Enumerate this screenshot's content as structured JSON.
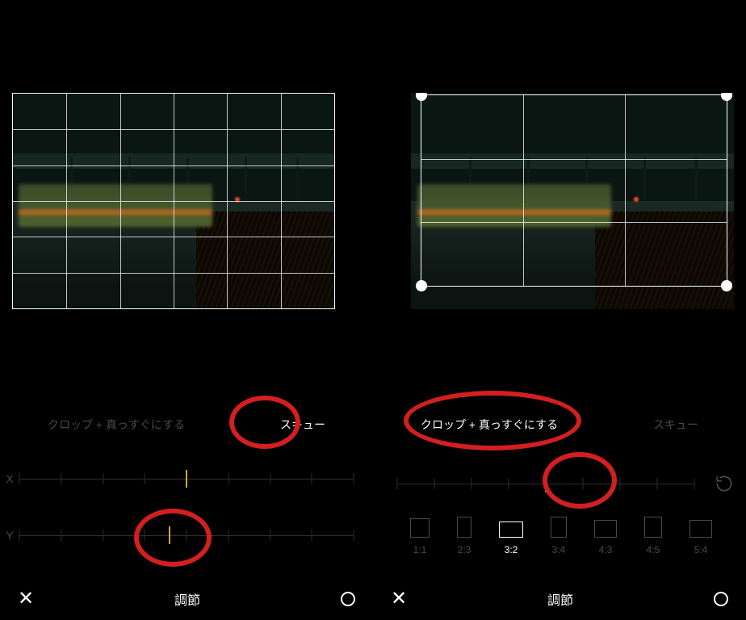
{
  "left_panel": {
    "tabs": {
      "crop_straighten": "クロップ + 真っすぐにする",
      "skew": "スキュー",
      "active": "skew"
    },
    "slider_x": {
      "label": "X",
      "cursor_pct": 50
    },
    "slider_y": {
      "label": "Y",
      "cursor_pct": 45
    },
    "footer": {
      "title": "調節"
    }
  },
  "right_panel": {
    "tabs": {
      "crop_straighten": "クロップ + 真っすぐにする",
      "skew": "スキュー",
      "active": "crop_straighten"
    },
    "slider": {
      "cursor_pct": 50
    },
    "aspect_ratios": [
      {
        "key": "1:1",
        "label": "1:1"
      },
      {
        "key": "2:3",
        "label": "2:3"
      },
      {
        "key": "3:2",
        "label": "3:2",
        "active": true
      },
      {
        "key": "3:4",
        "label": "3:4"
      },
      {
        "key": "4:3",
        "label": "4:3"
      },
      {
        "key": "4:5",
        "label": "4:5"
      },
      {
        "key": "5:4",
        "label": "5:4"
      }
    ],
    "footer": {
      "title": "調節"
    }
  },
  "annotations": [
    {
      "target": "left.tab.skew"
    },
    {
      "target": "left.slider.y.cursor"
    },
    {
      "target": "right.tab.crop_straighten"
    },
    {
      "target": "right.slider.cursor"
    }
  ]
}
